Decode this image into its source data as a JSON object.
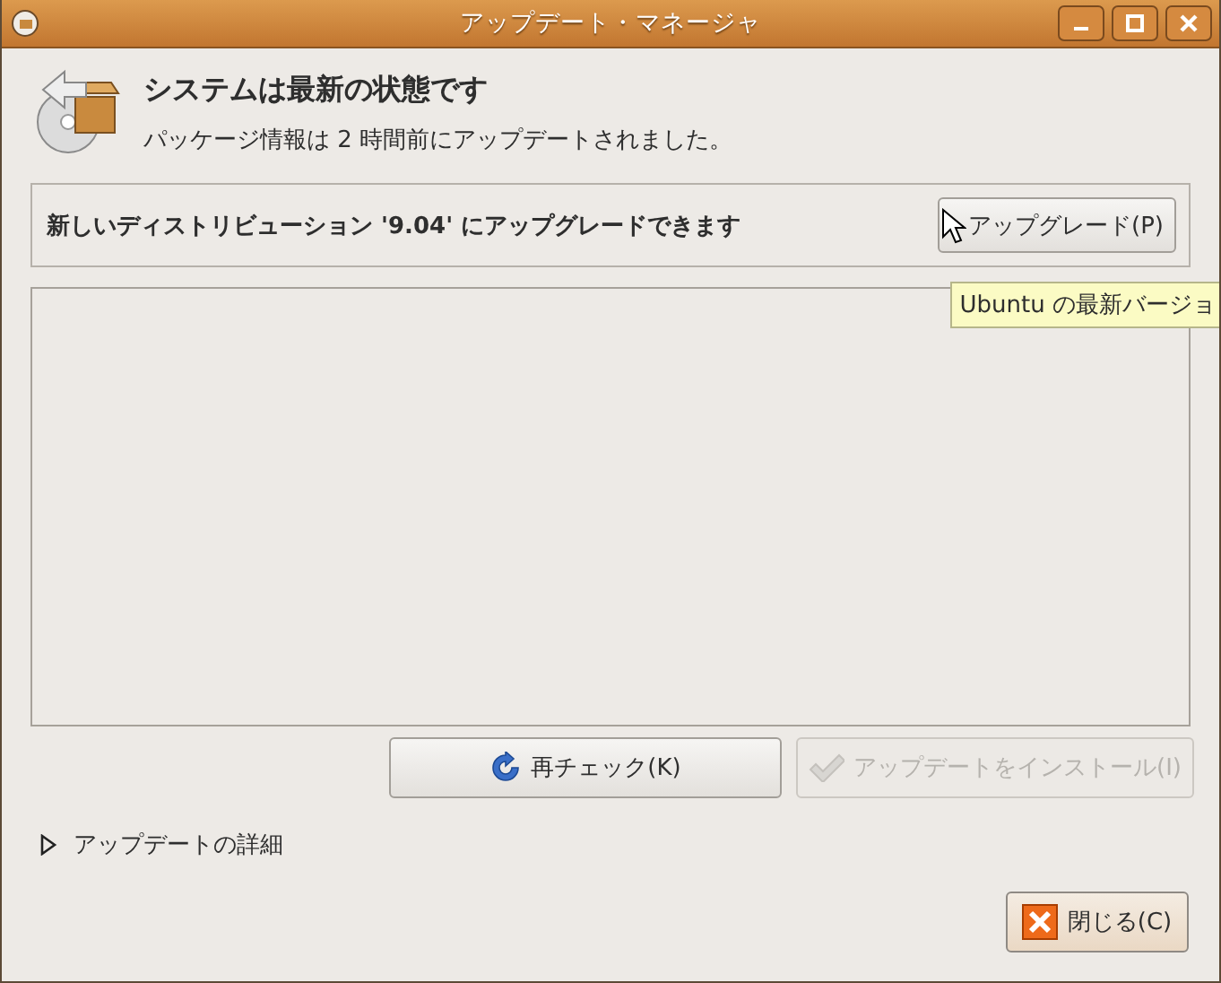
{
  "window": {
    "title": "アップデート・マネージャ"
  },
  "header": {
    "title": "システムは最新の状態です",
    "subtitle": "パッケージ情報は 2 時間前にアップデートされました。"
  },
  "upgrade_notice": {
    "text": "新しいディストリビューション '9.04' にアップグレードできます",
    "button": {
      "label": "アップグレード(P)",
      "disabled": false
    },
    "tooltip": "Ubuntu の最新バージョ"
  },
  "actions": [
    {
      "kind": "refresh",
      "label": "再チェック(K)",
      "disabled": false
    },
    {
      "kind": "install",
      "label": "アップデートをインストール(I)",
      "disabled": true
    }
  ],
  "details": {
    "label": "アップデートの詳細",
    "expanded": false
  },
  "close_button": {
    "label": "閉じる(C)",
    "disabled": false
  }
}
